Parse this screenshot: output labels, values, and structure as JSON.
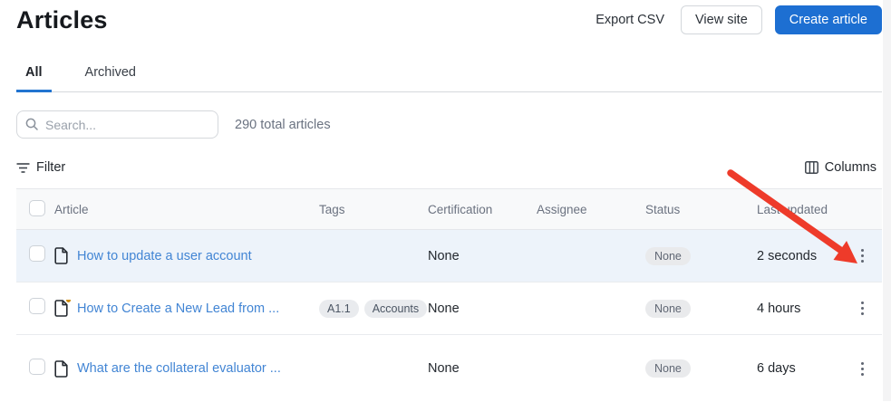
{
  "page": {
    "title": "Articles"
  },
  "top_actions": {
    "export_csv": "Export CSV",
    "view_site": "View site",
    "create_article": "Create article"
  },
  "tabs": [
    {
      "label": "All",
      "active": true
    },
    {
      "label": "Archived",
      "active": false
    }
  ],
  "search": {
    "placeholder": "Search...",
    "value": ""
  },
  "summary": {
    "total_text": "290 total articles"
  },
  "toolbar": {
    "filter_label": "Filter",
    "columns_label": "Columns"
  },
  "table": {
    "columns": [
      "Article",
      "Tags",
      "Certification",
      "Assignee",
      "Status",
      "Last updated"
    ],
    "rows": [
      {
        "title": "How to update a user account",
        "tags": [],
        "certification": "None",
        "assignee": "",
        "status": "None",
        "last_updated": "2 seconds",
        "highlighted": true,
        "unsaved_changes_dot": false
      },
      {
        "title": "How to Create a New Lead from ...",
        "tags": [
          "A1.1",
          "Accounts"
        ],
        "certification": "None",
        "assignee": "",
        "status": "None",
        "last_updated": "4 hours",
        "highlighted": false,
        "unsaved_changes_dot": true
      },
      {
        "title": "What are the collateral evaluator ...",
        "tags": [],
        "certification": "None",
        "assignee": "",
        "status": "None",
        "last_updated": "6 days",
        "highlighted": false,
        "unsaved_changes_dot": false
      }
    ]
  },
  "annotation": {
    "type": "red-arrow",
    "points_at": "row-1-kebab-menu",
    "color": "#ee3b2a"
  },
  "colors": {
    "primary_button": "#1d6fd2",
    "link": "#4285d4",
    "tab_underline": "#2274d0",
    "row_highlight": "#edf3fa",
    "badge_bg": "#e9eaec",
    "arrow_red": "#ee3b2a",
    "unsaved_dot": "#cf8c10"
  }
}
